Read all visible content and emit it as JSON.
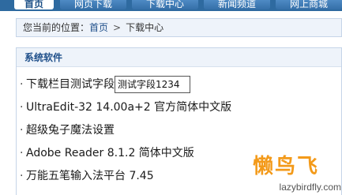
{
  "nav": {
    "tabs": [
      {
        "label": "首页",
        "active": true
      },
      {
        "label": "网页下载",
        "active": false
      },
      {
        "label": "下载中心",
        "active": false
      },
      {
        "label": "新闻频道",
        "active": false
      },
      {
        "label": "网上商城",
        "active": false
      }
    ]
  },
  "breadcrumb": {
    "prefix": "您当前的位置：",
    "home": "首页",
    "separator": ">",
    "current": "下载中心"
  },
  "section": {
    "title": "系统软件",
    "items": [
      {
        "bullet": "·",
        "label": "下载栏目测试字段"
      },
      {
        "bullet": "·",
        "label": "UltraEdit-32 14.00a+2 官方简体中文版"
      },
      {
        "bullet": "·",
        "label": "超级兔子魔法设置"
      },
      {
        "bullet": "·",
        "label": "Adobe Reader 8.1.2 简体中文版"
      },
      {
        "bullet": "·",
        "label": "万能五笔输入法平台 7.45"
      }
    ]
  },
  "tooltip": {
    "text": "测试字段1234"
  },
  "watermark": {
    "logo": "懒鸟飞",
    "url": "lazybirdfly.com"
  }
}
